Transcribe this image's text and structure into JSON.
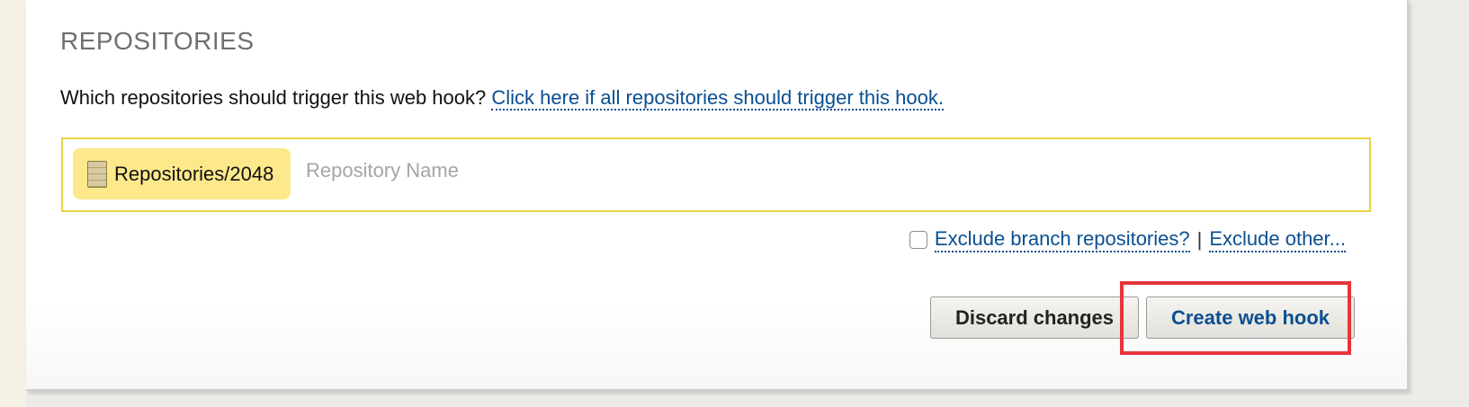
{
  "section": {
    "title": "REPOSITORIES",
    "question": "Which repositories should trigger this web hook?",
    "all_repos_link": "Click here if all repositories should trigger this hook."
  },
  "repo_selector": {
    "selected_token": "Repositories/2048",
    "token_icon": "repository-icon",
    "input_placeholder": "Repository Name",
    "input_value": ""
  },
  "exclude": {
    "branch_checkbox_checked": false,
    "branch_link": "Exclude branch repositories?",
    "separator": "|",
    "other_link": "Exclude other..."
  },
  "actions": {
    "discard_label": "Discard changes",
    "create_label": "Create web hook"
  },
  "colors": {
    "link": "#0a4f91",
    "token_bg": "#fde98b",
    "input_border": "#e6d44a",
    "highlight": "#e8353b"
  }
}
